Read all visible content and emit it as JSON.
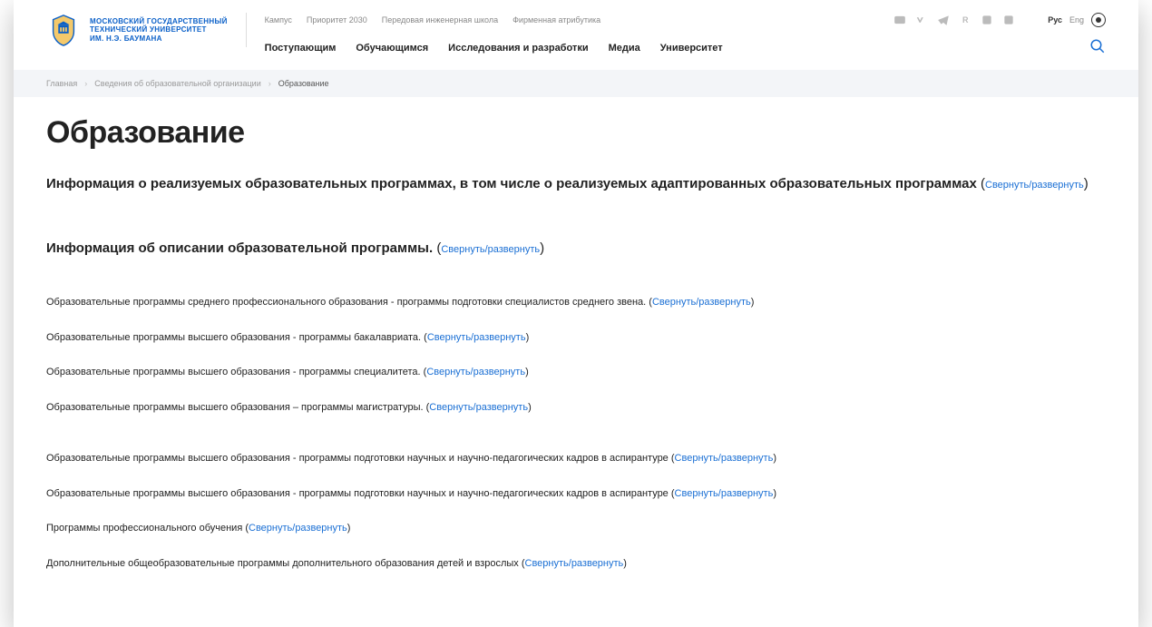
{
  "logo": {
    "line1": "МОСКОВСКИЙ ГОСУДАРСТВЕННЫЙ",
    "line2": "ТЕХНИЧЕСКИЙ УНИВЕРСИТЕТ",
    "line3": "ИМ. Н.Э. БАУМАНА"
  },
  "top_links": [
    "Кампус",
    "Приоритет 2030",
    "Передовая инженерная школа",
    "Фирменная атрибутика"
  ],
  "lang": {
    "ru": "Рус",
    "en": "Eng"
  },
  "main_nav": [
    "Поступающим",
    "Обучающимся",
    "Исследования и разработки",
    "Медиа",
    "Университет"
  ],
  "breadcrumb": {
    "home": "Главная",
    "sveden": "Сведения об образовательной организации",
    "current": "Образование"
  },
  "page_title": "Образование",
  "toggle_label": "Свернуть/развернуть",
  "sections": {
    "big1": "Информация о реализуемых образовательных программах, в том числе о реализуемых адаптированных образовательных программах",
    "big2": "Информация об описании образовательной программы.",
    "r1": "Образовательные программы среднего профессионального образования - программы подготовки специалистов среднего звена.",
    "r2": "Образовательные программы высшего образования - программы бакалавриата.",
    "r3": "Образовательные программы высшего образования - программы специалитета.",
    "r4": "Образовательные программы высшего образования – программы магистратуры.",
    "r5": "Образовательные программы высшего образования - программы подготовки научных и научно-педагогических кадров в аспирантуре",
    "r6": "Образовательные программы высшего образования - программы подготовки научных и научно-педагогических кадров в аспирантуре",
    "r7": "Программы профессионального обучения",
    "r8": "Дополнительные общеобразовательные программы дополнительного образования детей и взрослых"
  }
}
